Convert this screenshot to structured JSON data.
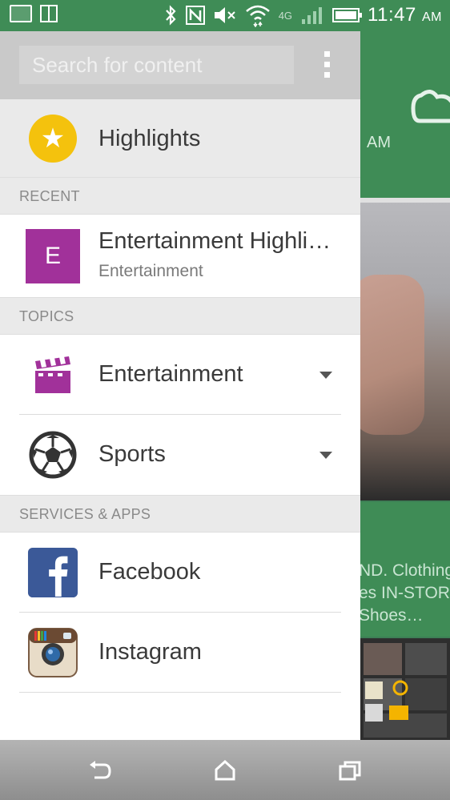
{
  "status_bar": {
    "network": "4G",
    "time": "11:47",
    "ampm": "AM"
  },
  "background": {
    "weather_ampm": "AM",
    "card_text_lines": [
      "ND. Clothing",
      "es IN-STORE",
      "Shoes…"
    ]
  },
  "drawer": {
    "search": {
      "placeholder": "Search for content",
      "value": ""
    },
    "highlights": {
      "label": "Highlights",
      "icon": "star-icon",
      "color": "#f4c20d"
    },
    "sections": {
      "recent": "RECENT",
      "topics": "TOPICS",
      "services": "SERVICES & APPS"
    },
    "recent_items": [
      {
        "letter": "E",
        "title": "Entertainment Highli…",
        "subtitle": "Entertainment",
        "color": "#a1319a"
      }
    ],
    "topics": [
      {
        "label": "Entertainment",
        "icon": "clapperboard-icon",
        "color": "#a1319a"
      },
      {
        "label": "Sports",
        "icon": "soccer-ball-icon"
      }
    ],
    "services": [
      {
        "label": "Facebook",
        "icon": "facebook-icon",
        "color": "#3b5998"
      },
      {
        "label": "Instagram",
        "icon": "instagram-icon"
      }
    ]
  },
  "nav_bar": {
    "buttons": [
      "back-icon",
      "home-icon",
      "recents-icon"
    ]
  }
}
